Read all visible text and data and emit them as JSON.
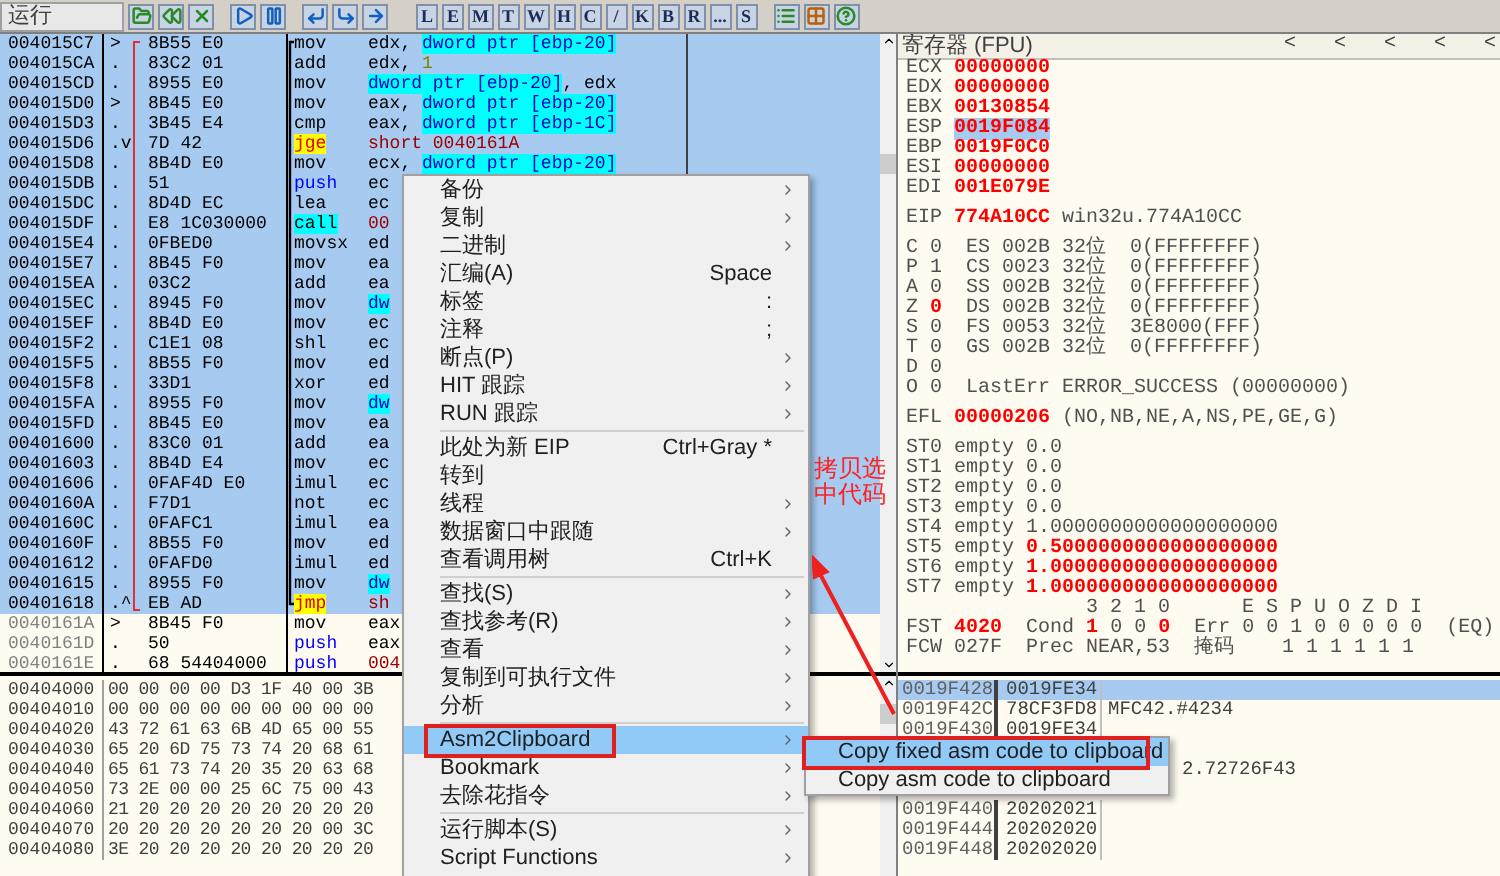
{
  "toolbar": {
    "status": "运行",
    "letter_buttons": [
      "L",
      "E",
      "M",
      "T",
      "W",
      "H",
      "C",
      "/",
      "K",
      "B",
      "R",
      "...",
      "S"
    ]
  },
  "disasm": {
    "rows": [
      {
        "address": "004015C7",
        "marker": ">",
        "bytes": "8B55 E0",
        "mnemonic": "mov",
        "kind": "plain",
        "operand": [
          {
            "text": "edx, ",
            "kind": "reg"
          },
          {
            "text": "dword ptr [ebp-20]",
            "kind": "mem"
          }
        ],
        "selected": true
      },
      {
        "address": "004015CA",
        "marker": ".",
        "bytes": "83C2 01",
        "mnemonic": "add",
        "kind": "plain",
        "operand": [
          {
            "text": "edx, ",
            "kind": "reg"
          },
          {
            "text": "1",
            "kind": "num"
          }
        ],
        "selected": true
      },
      {
        "address": "004015CD",
        "marker": ".",
        "bytes": "8955 E0",
        "mnemonic": "mov",
        "kind": "plain",
        "operand": [
          {
            "text": "dword ptr [ebp-20]",
            "kind": "mem"
          },
          {
            "text": ", edx",
            "kind": "reg"
          }
        ],
        "selected": true
      },
      {
        "address": "004015D0",
        "marker": ">",
        "bytes": "8B45 E0",
        "mnemonic": "mov",
        "kind": "plain",
        "operand": [
          {
            "text": "eax, ",
            "kind": "reg"
          },
          {
            "text": "dword ptr [ebp-20]",
            "kind": "mem"
          }
        ],
        "selected": true
      },
      {
        "address": "004015D3",
        "marker": ".",
        "bytes": "3B45 E4",
        "mnemonic": "cmp",
        "kind": "plain",
        "operand": [
          {
            "text": "eax, ",
            "kind": "reg"
          },
          {
            "text": "dword ptr [ebp-1C]",
            "kind": "mem"
          }
        ],
        "selected": true
      },
      {
        "address": "004015D6",
        "marker": ".v",
        "bytes": "7D 42",
        "mnemonic": "jge",
        "kind": "jump",
        "operand": [
          {
            "text": "short 0040161A",
            "kind": "addr"
          }
        ],
        "selected": true
      },
      {
        "address": "004015D8",
        "marker": ".",
        "bytes": "8B4D E0",
        "mnemonic": "mov",
        "kind": "plain",
        "operand": [
          {
            "text": "ecx, ",
            "kind": "reg"
          },
          {
            "text": "dword ptr [ebp-20]",
            "kind": "mem"
          }
        ],
        "selected": true
      },
      {
        "address": "004015DB",
        "marker": ".",
        "bytes": "51",
        "mnemonic": "push",
        "kind": "push",
        "operand": [
          {
            "text": "ec",
            "kind": "reg"
          }
        ],
        "selected": true
      },
      {
        "address": "004015DC",
        "marker": ".",
        "bytes": "8D4D EC",
        "mnemonic": "lea",
        "kind": "plain",
        "operand": [
          {
            "text": "ec",
            "kind": "reg"
          }
        ],
        "selected": true
      },
      {
        "address": "004015DF",
        "marker": ".",
        "bytes": "E8 1C030000",
        "mnemonic": "call",
        "kind": "call",
        "operand": [
          {
            "text": "00",
            "kind": "addr"
          }
        ],
        "selected": true
      },
      {
        "address": "004015E4",
        "marker": ".",
        "bytes": "0FBED0",
        "mnemonic": "movsx",
        "kind": "plain",
        "operand": [
          {
            "text": "ed",
            "kind": "reg"
          }
        ],
        "selected": true
      },
      {
        "address": "004015E7",
        "marker": ".",
        "bytes": "8B45 F0",
        "mnemonic": "mov",
        "kind": "plain",
        "operand": [
          {
            "text": "ea",
            "kind": "reg"
          }
        ],
        "selected": true
      },
      {
        "address": "004015EA",
        "marker": ".",
        "bytes": "03C2",
        "mnemonic": "add",
        "kind": "plain",
        "operand": [
          {
            "text": "ea",
            "kind": "reg"
          }
        ],
        "selected": true
      },
      {
        "address": "004015EC",
        "marker": ".",
        "bytes": "8945 F0",
        "mnemonic": "mov",
        "kind": "plain",
        "operand": [
          {
            "text": "dw",
            "kind": "mem"
          }
        ],
        "selected": true
      },
      {
        "address": "004015EF",
        "marker": ".",
        "bytes": "8B4D E0",
        "mnemonic": "mov",
        "kind": "plain",
        "operand": [
          {
            "text": "ec",
            "kind": "reg"
          }
        ],
        "selected": true
      },
      {
        "address": "004015F2",
        "marker": ".",
        "bytes": "C1E1 08",
        "mnemonic": "shl",
        "kind": "plain",
        "operand": [
          {
            "text": "ec",
            "kind": "reg"
          }
        ],
        "selected": true
      },
      {
        "address": "004015F5",
        "marker": ".",
        "bytes": "8B55 F0",
        "mnemonic": "mov",
        "kind": "plain",
        "operand": [
          {
            "text": "ed",
            "kind": "reg"
          }
        ],
        "selected": true
      },
      {
        "address": "004015F8",
        "marker": ".",
        "bytes": "33D1",
        "mnemonic": "xor",
        "kind": "plain",
        "operand": [
          {
            "text": "ed",
            "kind": "reg"
          }
        ],
        "selected": true
      },
      {
        "address": "004015FA",
        "marker": ".",
        "bytes": "8955 F0",
        "mnemonic": "mov",
        "kind": "plain",
        "operand": [
          {
            "text": "dw",
            "kind": "mem"
          }
        ],
        "selected": true
      },
      {
        "address": "004015FD",
        "marker": ".",
        "bytes": "8B45 E0",
        "mnemonic": "mov",
        "kind": "plain",
        "operand": [
          {
            "text": "ea",
            "kind": "reg"
          }
        ],
        "selected": true
      },
      {
        "address": "00401600",
        "marker": ".",
        "bytes": "83C0 01",
        "mnemonic": "add",
        "kind": "plain",
        "operand": [
          {
            "text": "ea",
            "kind": "reg"
          }
        ],
        "selected": true
      },
      {
        "address": "00401603",
        "marker": ".",
        "bytes": "8B4D E4",
        "mnemonic": "mov",
        "kind": "plain",
        "operand": [
          {
            "text": "ec",
            "kind": "reg"
          }
        ],
        "selected": true
      },
      {
        "address": "00401606",
        "marker": ".",
        "bytes": "0FAF4D E0",
        "mnemonic": "imul",
        "kind": "plain",
        "operand": [
          {
            "text": "ec",
            "kind": "reg"
          }
        ],
        "selected": true
      },
      {
        "address": "0040160A",
        "marker": ".",
        "bytes": "F7D1",
        "mnemonic": "not",
        "kind": "plain",
        "operand": [
          {
            "text": "ec",
            "kind": "reg"
          }
        ],
        "selected": true
      },
      {
        "address": "0040160C",
        "marker": ".",
        "bytes": "0FAFC1",
        "mnemonic": "imul",
        "kind": "plain",
        "operand": [
          {
            "text": "ea",
            "kind": "reg"
          }
        ],
        "selected": true
      },
      {
        "address": "0040160F",
        "marker": ".",
        "bytes": "8B55 F0",
        "mnemonic": "mov",
        "kind": "plain",
        "operand": [
          {
            "text": "ed",
            "kind": "reg"
          }
        ],
        "selected": true
      },
      {
        "address": "00401612",
        "marker": ".",
        "bytes": "0FAFD0",
        "mnemonic": "imul",
        "kind": "plain",
        "operand": [
          {
            "text": "ed",
            "kind": "reg"
          }
        ],
        "selected": true
      },
      {
        "address": "00401615",
        "marker": ".",
        "bytes": "8955 F0",
        "mnemonic": "mov",
        "kind": "plain",
        "operand": [
          {
            "text": "dw",
            "kind": "mem"
          }
        ],
        "selected": true
      },
      {
        "address": "00401618",
        "marker": ".^",
        "bytes": "EB AD",
        "mnemonic": "jmp",
        "kind": "jump",
        "operand": [
          {
            "text": "sh",
            "kind": "addr"
          }
        ],
        "selected": true
      },
      {
        "address": "0040161A",
        "marker": ">",
        "bytes": "8B45 F0",
        "mnemonic": "mov",
        "kind": "plain",
        "operand": [
          {
            "text": "eax",
            "kind": "reg"
          }
        ],
        "selected": false
      },
      {
        "address": "0040161D",
        "marker": ".",
        "bytes": "50",
        "mnemonic": "push",
        "kind": "push",
        "operand": [
          {
            "text": "eax",
            "kind": "reg"
          }
        ],
        "selected": false
      },
      {
        "address": "0040161E",
        "marker": ".",
        "bytes": "68 54404000",
        "mnemonic": "push",
        "kind": "push",
        "operand": [
          {
            "text": "004",
            "kind": "addr"
          }
        ],
        "selected": false
      }
    ]
  },
  "dump": {
    "rows": [
      {
        "address": "00404000",
        "bytes": "00 00 00 00 D3 1F 40 00 3B"
      },
      {
        "address": "00404010",
        "bytes": "00 00 00 00 00 00 00 00 00"
      },
      {
        "address": "00404020",
        "bytes": "43 72 61 63 6B 4D 65 00 55"
      },
      {
        "address": "00404030",
        "bytes": "65 20 6D 75 73 74 20 68 61"
      },
      {
        "address": "00404040",
        "bytes": "65 61 73 74 20 35 20 63 68"
      },
      {
        "address": "00404050",
        "bytes": "73 2E 00 00 25 6C 75 00 43"
      },
      {
        "address": "00404060",
        "bytes": "21 20 20 20 20 20 20 20 20"
      },
      {
        "address": "00404070",
        "bytes": "20 20 20 20 20 20 20 00 3C"
      },
      {
        "address": "00404080",
        "bytes": "3E 20 20 20 20 20 20 20 20"
      }
    ]
  },
  "registers": {
    "title": "寄存器 (FPU)",
    "header_arrows": [
      "<",
      "<",
      "<",
      "<",
      "<"
    ],
    "blocks": [
      [
        [
          {
            "text": "ECX ",
            "kind": "text"
          },
          {
            "text": "00000000",
            "kind": "changed"
          }
        ],
        [
          {
            "text": "EDX ",
            "kind": "text"
          },
          {
            "text": "00000000",
            "kind": "changed"
          }
        ],
        [
          {
            "text": "EBX ",
            "kind": "text"
          },
          {
            "text": "00130854",
            "kind": "changed"
          }
        ],
        [
          {
            "text": "ESP ",
            "kind": "text"
          },
          {
            "text": "0019F084",
            "kind": "selected"
          }
        ],
        [
          {
            "text": "EBP ",
            "kind": "text"
          },
          {
            "text": "0019F0C0",
            "kind": "changed"
          }
        ],
        [
          {
            "text": "ESI ",
            "kind": "text"
          },
          {
            "text": "00000000",
            "kind": "changed"
          }
        ],
        [
          {
            "text": "EDI ",
            "kind": "text"
          },
          {
            "text": "001E079E",
            "kind": "changed"
          }
        ]
      ],
      [
        [
          {
            "text": "EIP ",
            "kind": "text"
          },
          {
            "text": "774A10CC",
            "kind": "changed"
          },
          {
            "text": " win32u.774A10CC",
            "kind": "text"
          }
        ]
      ],
      [
        [
          {
            "text": "C 0  ES 002B 32位  0(FFFFFFFF)",
            "kind": "text"
          }
        ],
        [
          {
            "text": "P 1  CS 0023 32位  0(FFFFFFFF)",
            "kind": "text"
          }
        ],
        [
          {
            "text": "A 0  SS 002B 32位  0(FFFFFFFF)",
            "kind": "text"
          }
        ],
        [
          {
            "text": "Z ",
            "kind": "text"
          },
          {
            "text": "0",
            "kind": "changed"
          },
          {
            "text": "  DS 002B 32位  0(FFFFFFFF)",
            "kind": "text"
          }
        ],
        [
          {
            "text": "S 0  FS 0053 32位  3E8000(FFF)",
            "kind": "text"
          }
        ],
        [
          {
            "text": "T 0  GS 002B 32位  0(FFFFFFFF)",
            "kind": "text"
          }
        ],
        [
          {
            "text": "D 0",
            "kind": "text"
          }
        ],
        [
          {
            "text": "O 0  LastErr ERROR_SUCCESS (00000000)",
            "kind": "text"
          }
        ]
      ],
      [
        [
          {
            "text": "EFL ",
            "kind": "text"
          },
          {
            "text": "00000206",
            "kind": "changed"
          },
          {
            "text": " (NO,NB,NE,A,NS,PE,GE,G)",
            "kind": "text"
          }
        ]
      ],
      [
        [
          {
            "text": "ST0 empty 0.0",
            "kind": "text"
          }
        ],
        [
          {
            "text": "ST1 empty 0.0",
            "kind": "text"
          }
        ],
        [
          {
            "text": "ST2 empty 0.0",
            "kind": "text"
          }
        ],
        [
          {
            "text": "ST3 empty 0.0",
            "kind": "text"
          }
        ],
        [
          {
            "text": "ST4 empty 1.0000000000000000000",
            "kind": "text"
          }
        ],
        [
          {
            "text": "ST5 empty ",
            "kind": "text"
          },
          {
            "text": "0.5000000000000000000",
            "kind": "changed"
          }
        ],
        [
          {
            "text": "ST6 empty ",
            "kind": "text"
          },
          {
            "text": "1.0000000000000000000",
            "kind": "changed"
          }
        ],
        [
          {
            "text": "ST7 empty ",
            "kind": "text"
          },
          {
            "text": "1.0000000000000000000",
            "kind": "changed"
          }
        ],
        [
          {
            "text": "               3 2 1 0      E S P U O Z D I",
            "kind": "text"
          }
        ],
        [
          {
            "text": "FST ",
            "kind": "text"
          },
          {
            "text": "4020",
            "kind": "changed"
          },
          {
            "text": "  Cond ",
            "kind": "text"
          },
          {
            "text": "1",
            "kind": "changed"
          },
          {
            "text": " 0 0 ",
            "kind": "text"
          },
          {
            "text": "0",
            "kind": "changed"
          },
          {
            "text": "  Err 0 0 1 0 0 0 0 0  (EQ)",
            "kind": "text"
          }
        ],
        [
          {
            "text": "FCW 027F  Prec NEAR,53  掩码    1 1 1 1 1 1",
            "kind": "text"
          }
        ]
      ]
    ]
  },
  "stack": {
    "rows": [
      {
        "kind": "row",
        "address": "0019F428",
        "value": "0019FE34",
        "selected": true
      },
      {
        "kind": "row",
        "address": "0019F42C",
        "value": "78CF3FD8",
        "comment": "MFC42.#4234",
        "selected": false
      },
      {
        "kind": "row",
        "address": "0019F430",
        "value": "0019FE34",
        "selected": false
      },
      {
        "kind": "covered",
        "selected": false
      },
      {
        "kind": "covered",
        "comment": "2.72726F43",
        "selected": false
      },
      {
        "kind": "covered",
        "selected": false
      },
      {
        "kind": "row",
        "address": "0019F440",
        "value": "20202021",
        "selected": false
      },
      {
        "kind": "row",
        "address": "0019F444",
        "value": "20202020",
        "selected": false
      },
      {
        "kind": "row",
        "address": "0019F448",
        "value": "20202020",
        "selected": false
      }
    ]
  },
  "context_menu": {
    "items": [
      {
        "kind": "item",
        "label": "备份",
        "submenu": true,
        "selected": false,
        "boxed": false
      },
      {
        "kind": "item",
        "label": "复制",
        "submenu": true,
        "selected": false,
        "boxed": false
      },
      {
        "kind": "item",
        "label": "二进制",
        "submenu": true,
        "selected": false,
        "boxed": false
      },
      {
        "kind": "item",
        "label": "汇编(A)",
        "shortcut": "Space",
        "submenu": false,
        "selected": false,
        "boxed": false
      },
      {
        "kind": "item",
        "label": "标签",
        "shortcut": ":",
        "submenu": false,
        "selected": false,
        "boxed": false
      },
      {
        "kind": "item",
        "label": "注释",
        "shortcut": ";",
        "submenu": false,
        "selected": false,
        "boxed": false
      },
      {
        "kind": "item",
        "label": "断点(P)",
        "submenu": true,
        "selected": false,
        "boxed": false
      },
      {
        "kind": "item",
        "label": "HIT 跟踪",
        "submenu": true,
        "selected": false,
        "boxed": false
      },
      {
        "kind": "item",
        "label": "RUN 跟踪",
        "submenu": true,
        "selected": false,
        "boxed": false
      },
      {
        "kind": "separator"
      },
      {
        "kind": "item",
        "label": "此处为新 EIP",
        "shortcut": "Ctrl+Gray *",
        "submenu": false,
        "selected": false,
        "boxed": false
      },
      {
        "kind": "item",
        "label": "转到",
        "submenu": false,
        "selected": false,
        "boxed": false
      },
      {
        "kind": "item",
        "label": "线程",
        "submenu": true,
        "selected": false,
        "boxed": false
      },
      {
        "kind": "item",
        "label": "数据窗口中跟随",
        "submenu": true,
        "selected": false,
        "boxed": false
      },
      {
        "kind": "item",
        "label": "查看调用树",
        "shortcut": "Ctrl+K",
        "submenu": false,
        "selected": false,
        "boxed": false
      },
      {
        "kind": "separator"
      },
      {
        "kind": "item",
        "label": "查找(S)",
        "submenu": true,
        "selected": false,
        "boxed": false
      },
      {
        "kind": "item",
        "label": "查找参考(R)",
        "submenu": true,
        "selected": false,
        "boxed": false
      },
      {
        "kind": "item",
        "label": "查看",
        "submenu": true,
        "selected": false,
        "boxed": false
      },
      {
        "kind": "item",
        "label": "复制到可执行文件",
        "submenu": true,
        "selected": false,
        "boxed": false
      },
      {
        "kind": "item",
        "label": "分析",
        "submenu": true,
        "selected": false,
        "boxed": false
      },
      {
        "kind": "separator"
      },
      {
        "kind": "item",
        "label": "Asm2Clipboard",
        "submenu": true,
        "selected": true,
        "boxed": true
      },
      {
        "kind": "item",
        "label": "Bookmark",
        "submenu": true,
        "selected": false,
        "boxed": false
      },
      {
        "kind": "item",
        "label": "去除花指令",
        "submenu": true,
        "selected": false,
        "boxed": false
      },
      {
        "kind": "separator"
      },
      {
        "kind": "item",
        "label": "运行脚本(S)",
        "submenu": true,
        "selected": false,
        "boxed": false
      },
      {
        "kind": "item",
        "label": "Script Functions",
        "submenu": true,
        "selected": false,
        "boxed": false
      }
    ]
  },
  "submenu": {
    "items": [
      {
        "label": "Copy fixed asm code to clipboard",
        "selected": true,
        "boxed": true
      },
      {
        "label": "Copy asm code to clipboard",
        "selected": false,
        "boxed": false
      }
    ]
  },
  "annotation": {
    "text": "拷贝选中代码"
  }
}
